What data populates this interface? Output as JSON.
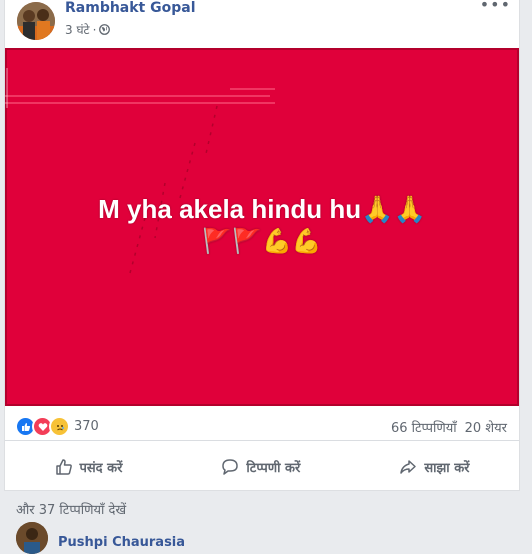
{
  "post": {
    "author": "Rambhakt Gopal",
    "time": "3 घंटे",
    "time_separator": "·",
    "more_label": "•••",
    "image_text": "M yha akela hindu hu🙏🙏",
    "image_emojis": "🚩🚩💪💪",
    "bg_color": "#e0003a"
  },
  "stats": {
    "reaction_count": "370",
    "comments": "66 टिप्पणियाँ",
    "shares": "20 शेयर"
  },
  "actions": {
    "like": "पसंद करें",
    "comment": "टिप्पणी करें",
    "share": "साझा करें"
  },
  "comments": {
    "more_comments": "और 37 टिप्पणियाँ देखें",
    "first_commenter": "Pushpi Chaurasia"
  }
}
